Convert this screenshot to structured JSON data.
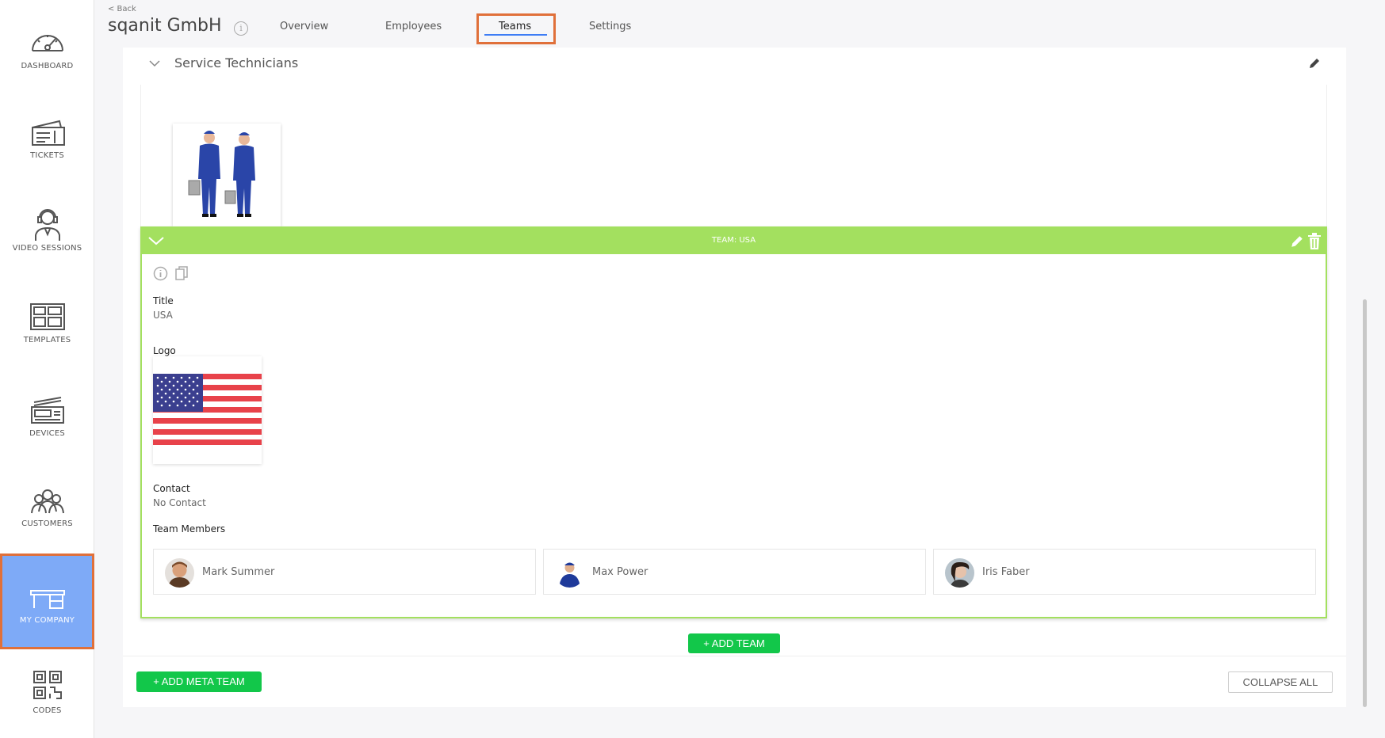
{
  "sidebar": {
    "items": [
      {
        "label": "DASHBOARD",
        "icon": "speedometer-icon"
      },
      {
        "label": "TICKETS",
        "icon": "ticket-icon"
      },
      {
        "label": "VIDEO SESSIONS",
        "icon": "headset-agent-icon"
      },
      {
        "label": "TEMPLATES",
        "icon": "template-grid-icon"
      },
      {
        "label": "DEVICES",
        "icon": "device-icon"
      },
      {
        "label": "CUSTOMERS",
        "icon": "customers-icon"
      },
      {
        "label": "MY COMPANY",
        "icon": "desk-icon",
        "active": true
      },
      {
        "label": "CODES",
        "icon": "qr-code-icon"
      }
    ]
  },
  "header": {
    "back": "< Back",
    "title": "sqanit GmbH",
    "info_glyph": "i",
    "tabs": [
      "Overview",
      "Employees",
      "Teams",
      "Settings"
    ],
    "active_tab": "Teams"
  },
  "meta_team": {
    "title": "Service Technicians"
  },
  "team": {
    "bar_title": "TEAM: USA",
    "title_label": "Title",
    "title_value": "USA",
    "logo_label": "Logo",
    "contact_label": "Contact",
    "contact_value": "No Contact",
    "members_label": "Team Members",
    "members": [
      {
        "name": "Mark Summer"
      },
      {
        "name": "Max Power"
      },
      {
        "name": "Iris Faber"
      }
    ]
  },
  "buttons": {
    "add_team": "+ ADD TEAM",
    "add_meta_team": "+ ADD META TEAM",
    "collapse_all": "COLLAPSE ALL"
  },
  "colors": {
    "accent_green": "#a3e05f",
    "button_green": "#12c74a",
    "active_nav": "#7eaaf7",
    "highlight_orange": "#e0703a",
    "tab_underline": "#3e7df5"
  }
}
